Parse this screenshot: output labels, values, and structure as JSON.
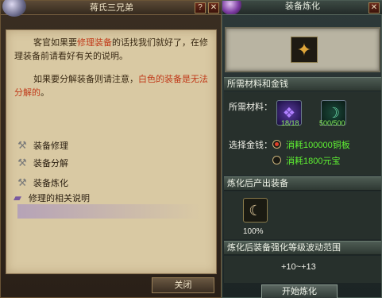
{
  "npc_dialog": {
    "title": "蒋氏三兄弟",
    "help_glyph": "?",
    "close_glyph": "✕",
    "paragraph1": {
      "pre": "客官如果要",
      "highlight": "修理装备",
      "post": "的话找我们就好了，在修理装备前请看好有关的说明。"
    },
    "paragraph2": {
      "pre": "如果要分解装备则请注意，",
      "highlight": "白色的装备是无法分解的",
      "post": "。"
    },
    "options": [
      {
        "label": "装备修理",
        "icon": "hammer-icon"
      },
      {
        "label": "装备分解",
        "icon": "hammer-icon"
      },
      {
        "label": "装备炼化",
        "icon": "hammer-icon"
      },
      {
        "label": "修理的相关说明",
        "icon": "book-icon"
      }
    ],
    "close_button": "关闭"
  },
  "refine_panel": {
    "title": "装备炼化",
    "close_glyph": "✕",
    "materials_header": "所需材料和金钱",
    "materials_label": "所需材料：",
    "materials": [
      {
        "count": "18/18",
        "icon": "purple-crystal-icon"
      },
      {
        "count": "500/500",
        "icon": "green-rune-icon"
      }
    ],
    "money_label": "选择金钱：",
    "money_options": [
      {
        "label": "消耗100000铜板",
        "selected": true
      },
      {
        "label": "消耗1800元宝",
        "selected": false
      }
    ],
    "output_header": "炼化后产出装备",
    "output_chance": "100%",
    "range_header": "炼化后装备强化等级波动范围",
    "range_value": "+10~+13",
    "start_button": "开始炼化"
  },
  "colors": {
    "highlight_red": "#c03a1a",
    "material_count_green": "#8cf05a",
    "money_text_green": "#5ef032"
  }
}
